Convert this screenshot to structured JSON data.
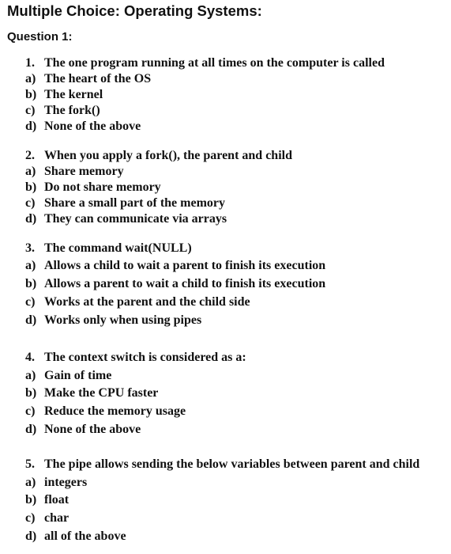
{
  "page": {
    "title": "Multiple Choice: Operating Systems:",
    "subtitle": "Question 1:"
  },
  "questions": [
    {
      "number": "1.",
      "text": "The one program running at all times on the computer is called",
      "options": [
        {
          "letter": "a)",
          "text": "The heart of the OS"
        },
        {
          "letter": "b)",
          "text": "The kernel"
        },
        {
          "letter": "c)",
          "text": "The fork()"
        },
        {
          "letter": "d)",
          "text": "None of the above"
        }
      ]
    },
    {
      "number": "2.",
      "text": "When you apply a fork(), the parent and child",
      "options": [
        {
          "letter": "a)",
          "text": "Share memory"
        },
        {
          "letter": "b)",
          "text": "Do not share memory"
        },
        {
          "letter": "c)",
          "text": "Share a small part of the memory"
        },
        {
          "letter": "d)",
          "text": "They can communicate via arrays"
        }
      ]
    },
    {
      "number": "3.",
      "text": "The command wait(NULL)",
      "options": [
        {
          "letter": "a)",
          "text": "Allows a child to wait a parent to finish its execution"
        },
        {
          "letter": "b)",
          "text": "Allows a parent to wait a child to finish its execution"
        },
        {
          "letter": "c)",
          "text": "Works at the parent and the child side"
        },
        {
          "letter": "d)",
          "text": "Works only when using pipes"
        }
      ]
    },
    {
      "number": "4.",
      "text": "The context switch is considered as a:",
      "options": [
        {
          "letter": "a)",
          "text": "Gain of time"
        },
        {
          "letter": "b)",
          "text": "Make the CPU faster"
        },
        {
          "letter": "c)",
          "text": "Reduce the memory usage"
        },
        {
          "letter": "d)",
          "text": "None of the above"
        }
      ]
    },
    {
      "number": "5.",
      "text": "The pipe allows sending the below variables between parent and child",
      "options": [
        {
          "letter": "a)",
          "text": "integers"
        },
        {
          "letter": "b)",
          "text": "float"
        },
        {
          "letter": "c)",
          "text": "char"
        },
        {
          "letter": "d)",
          "text": "all of the above"
        }
      ]
    }
  ]
}
